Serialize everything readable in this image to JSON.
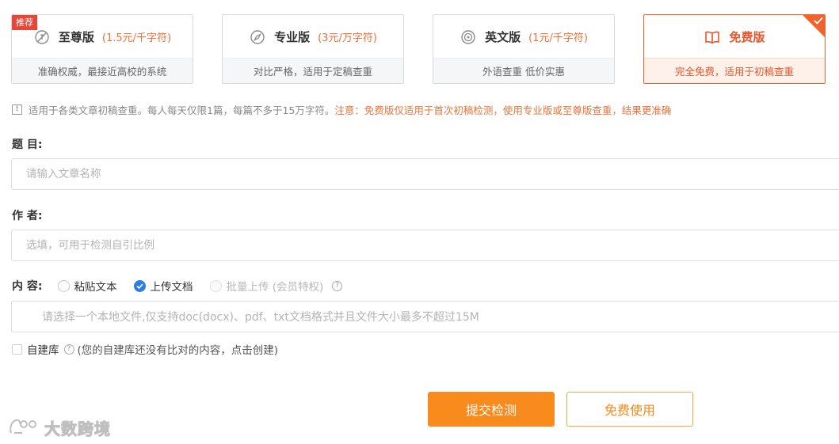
{
  "plans": [
    {
      "name": "至尊版",
      "price": "(1.5元/千字符)",
      "desc": "准确权威，最接近高校的系统",
      "badge": "推荐",
      "icon": "no-ring-icon",
      "selected": false
    },
    {
      "name": "专业版",
      "price": "(3元/万字符)",
      "desc": "对比严格，适用于定稿查重",
      "icon": "compass-icon",
      "selected": false
    },
    {
      "name": "英文版",
      "price": "(1元/千字符)",
      "desc": "外语查重 低价实惠",
      "icon": "target-icon",
      "selected": false
    },
    {
      "name": "免费版",
      "price": "",
      "desc": "完全免费，适用于初稿查重",
      "icon": "book-icon",
      "selected": true
    }
  ],
  "notice": {
    "text": "适用于各类文章初稿查重。每人每天仅限1篇，每篇不多于15万字符。",
    "warning": "注意：免费版仅适用于首次初稿检测，使用专业版或至尊版查重，结果更准确"
  },
  "form": {
    "title_label": "题 目:",
    "title_placeholder": "请输入文章名称",
    "author_label": "作 者:",
    "author_placeholder": "选填，可用于检测自引比例",
    "content_label": "内 容:",
    "content_options": [
      {
        "label": "粘贴文本",
        "checked": false,
        "disabled": false
      },
      {
        "label": "上传文档",
        "checked": true,
        "disabled": false
      },
      {
        "label": "批量上传 (会员特权)",
        "checked": false,
        "disabled": true
      }
    ],
    "upload_hint": "请选择一个本地文件,仅支持doc(docx)、pdf、txt文档格式并且文件大小最多不超过15M",
    "library_label": "自建库",
    "library_hint": "(您的自建库还没有比对的内容，点击创建)"
  },
  "buttons": {
    "submit": "提交检测",
    "free": "免费使用"
  },
  "watermark": {
    "text": "大数跨境"
  },
  "colors": {
    "accent_orange": "#f98a1c",
    "selected_red": "#f0622e",
    "warning_text": "#e8733a",
    "checked_blue": "#2f7be8",
    "badge_red": "#e84536"
  }
}
